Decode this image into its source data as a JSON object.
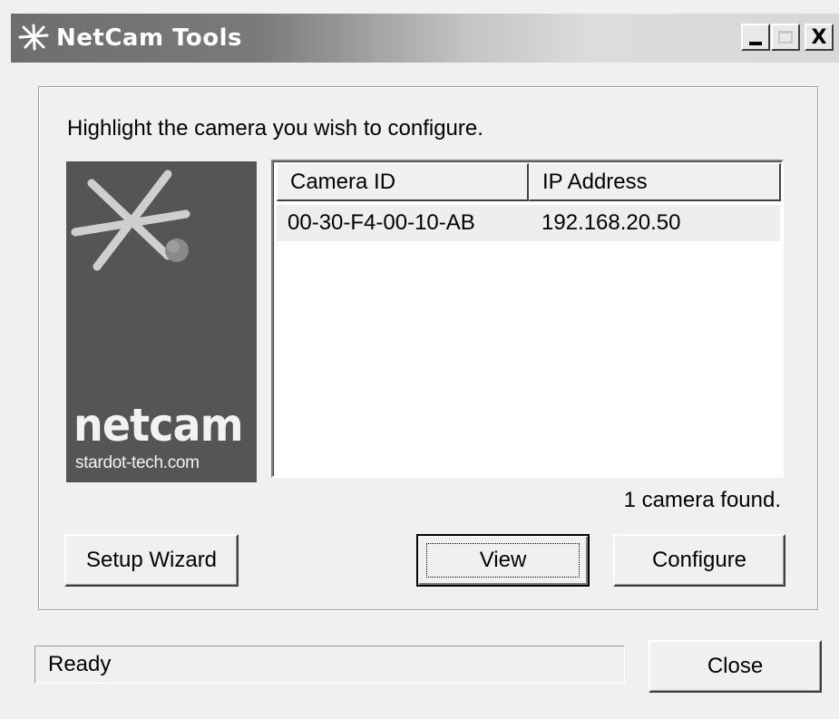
{
  "window": {
    "title": "NetCam Tools",
    "controls": {
      "minimize": "_",
      "maximize": "",
      "close": "X"
    }
  },
  "dialog": {
    "instruction": "Highlight the camera you wish to configure.",
    "logo": {
      "word": "netcam",
      "url": "stardot-tech.com"
    },
    "camera_list": {
      "columns": [
        "Camera ID",
        "IP Address"
      ],
      "rows": [
        {
          "camera_id": "00-30-F4-00-10-AB",
          "ip_address": "192.168.20.50"
        }
      ]
    },
    "found_text": "1 camera found.",
    "buttons": {
      "setup_wizard": "Setup Wizard",
      "view": "View",
      "configure": "Configure",
      "close": "Close"
    },
    "status": "Ready"
  },
  "colors": {
    "face": "#f0f0f0",
    "logo_background": "#555555",
    "title_gradient_start": "#6e6e6e"
  }
}
